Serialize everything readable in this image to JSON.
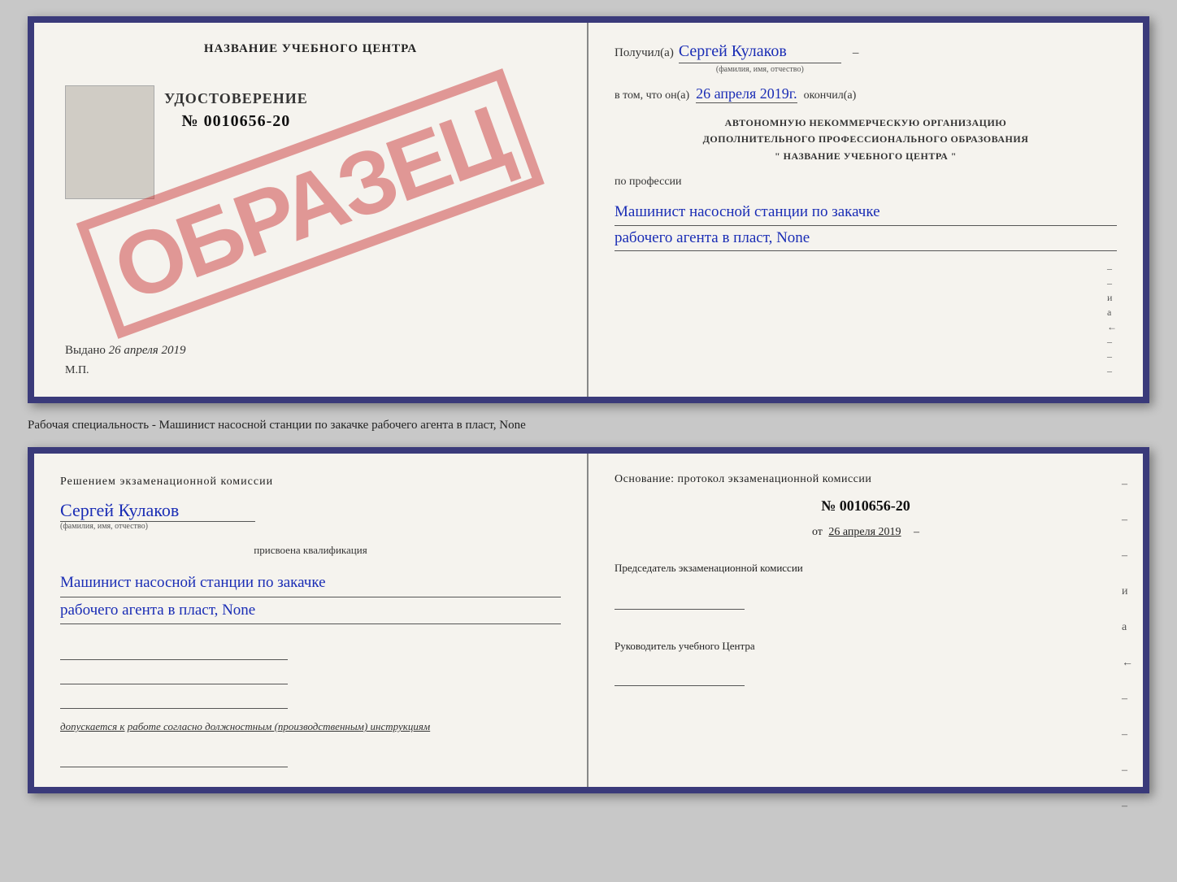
{
  "cert_top": {
    "school_name": "НАЗВАНИЕ УЧЕБНОГО ЦЕНТРА",
    "udostoverenie_title": "УДОСТОВЕРЕНИЕ",
    "udostoverenie_num": "№ 0010656-20",
    "stamp": "ОБРАЗЕЦ",
    "vydano_label": "Выдано",
    "vydano_date": "26 апреля 2019",
    "mp_label": "М.П.",
    "poluchil_label": "Получил(а)",
    "recipient_name": "Сергей Кулаков",
    "fio_hint": "(фамилия, имя, отчество)",
    "dash1": "–",
    "vtom_label": "в том, что он(а)",
    "completion_date": "26 апреля 2019г.",
    "okonchil_label": "окончил(а)",
    "avt_line1": "АВТОНОМНУЮ НЕКОММЕРЧЕСКУЮ ОРГАНИЗАЦИЮ",
    "avt_line2": "ДОПОЛНИТЕЛЬНОГО ПРОФЕССИОНАЛЬНОГО ОБРАЗОВАНИЯ",
    "avt_line3": "\" НАЗВАНИЕ УЧЕБНОГО ЦЕНТРА \"",
    "po_professii_label": "по профессии",
    "profession1": "Машинист насосной станции по закачке",
    "profession2": "рабочего агента в пласт, None",
    "right_dashes": [
      "–",
      "–",
      "–",
      "и",
      "а",
      "←",
      "–",
      "–",
      "–"
    ]
  },
  "caption": {
    "text": "Рабочая специальность - Машинист насосной станции по закачке рабочего агента в пласт, None"
  },
  "cert_bottom": {
    "resheniye_text": "Решением экзаменационной комиссии",
    "name_handwritten": "Сергей Кулаков",
    "fio_hint": "(фамилия, имя, отчество)",
    "prisvoena_text": "присвоена квалификация",
    "qual1": "Машинист насосной станции по закачке",
    "qual2": "рабочего агента в пласт, None",
    "dopuskaetsya_prefix": "допускается к",
    "dopuskaetsya_text": "работе согласно должностным (производственным) инструкциям",
    "osnovanie_text": "Основание: протокол экзаменационной комиссии",
    "protocol_num": "№ 0010656-20",
    "ot_label": "от",
    "ot_date": "26 апреля 2019",
    "predsedatel_text": "Председатель экзаменационной комиссии",
    "rukovoditel_text": "Руководитель учебного Центра",
    "right_dashes": [
      "–",
      "–",
      "–",
      "и",
      "а",
      "←",
      "–",
      "–",
      "–",
      "–"
    ]
  }
}
